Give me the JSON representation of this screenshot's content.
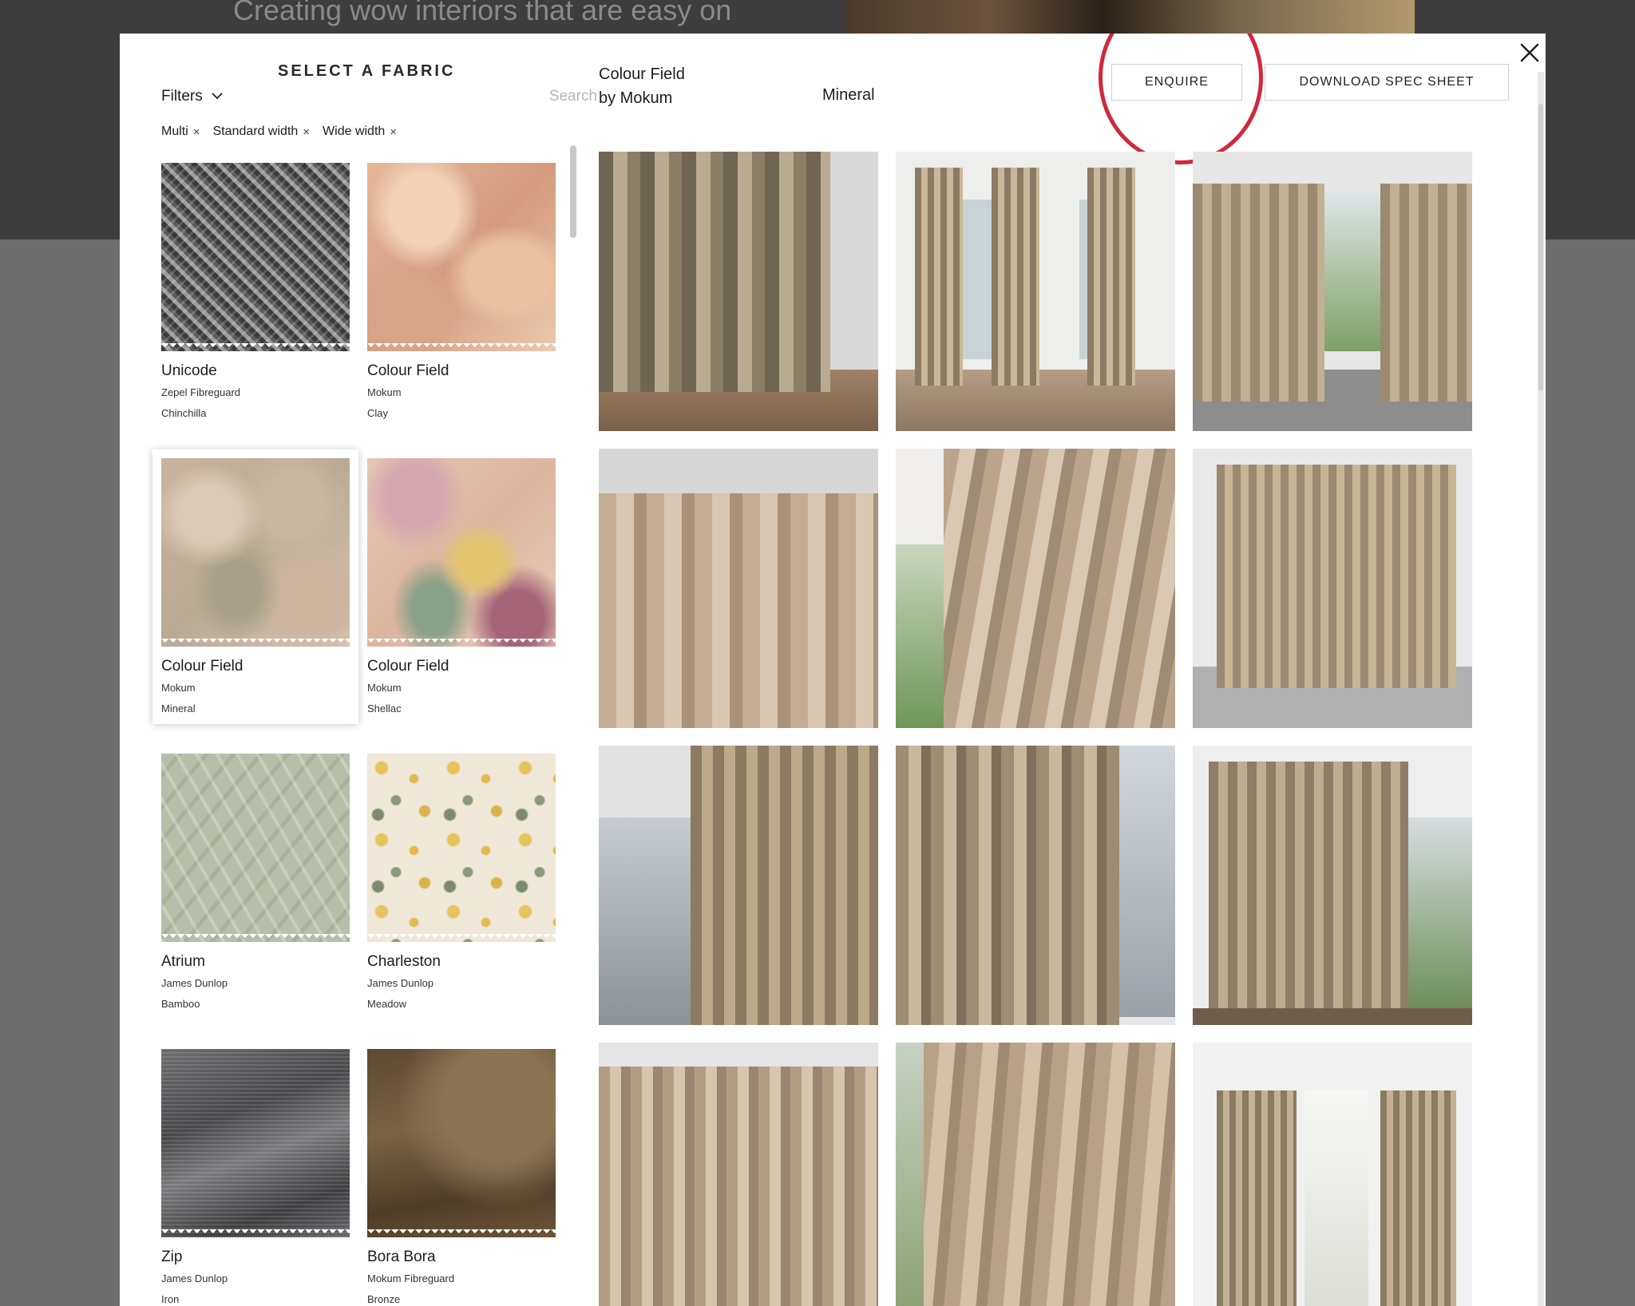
{
  "background": {
    "tagline": "Creating wow interiors that are easy on"
  },
  "modal": {
    "close_icon": "close-icon",
    "panel": {
      "title": "SELECT A FABRIC",
      "filters_label": "Filters",
      "filters_icon": "chevron-down-icon",
      "search_placeholder": "Search",
      "active_filters": [
        {
          "label": "Multi",
          "remove": "×"
        },
        {
          "label": "Standard width",
          "remove": "×"
        },
        {
          "label": "Wide width",
          "remove": "×"
        }
      ],
      "fabrics": [
        {
          "name": "Unicode",
          "brand": "Zepel Fibreguard",
          "color": "Chinchilla",
          "selected": false
        },
        {
          "name": "Colour Field",
          "brand": "Mokum",
          "color": "Clay",
          "selected": false
        },
        {
          "name": "Colour Field",
          "brand": "Mokum",
          "color": "Mineral",
          "selected": true
        },
        {
          "name": "Colour Field",
          "brand": "Mokum",
          "color": "Shellac",
          "selected": false
        },
        {
          "name": "Atrium",
          "brand": "James Dunlop",
          "color": "Bamboo",
          "selected": false
        },
        {
          "name": "Charleston",
          "brand": "James Dunlop",
          "color": "Meadow",
          "selected": false
        },
        {
          "name": "Zip",
          "brand": "James Dunlop",
          "color": "Iron",
          "selected": false
        },
        {
          "name": "Bora Bora",
          "brand": "Mokum Fibreguard",
          "color": "Bronze",
          "selected": false
        }
      ]
    },
    "product": {
      "name_line1": "Colour Field",
      "name_line2": "by Mokum",
      "color": "Mineral"
    },
    "buttons": {
      "enquire": "ENQUIRE",
      "download": "DOWNLOAD SPEC SHEET"
    },
    "highlight_color": "#d2283c",
    "gallery_count": 12
  }
}
